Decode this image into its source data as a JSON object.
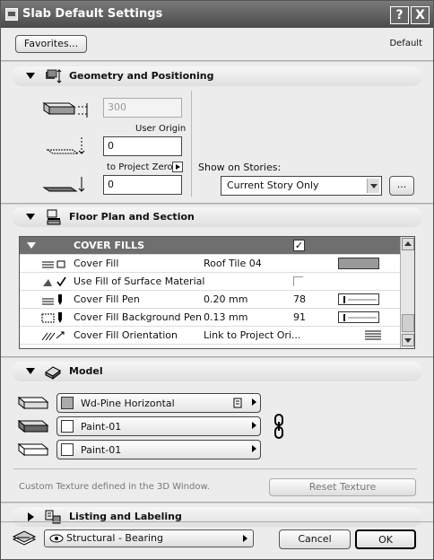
{
  "window": {
    "title": "Slab Default Settings",
    "help_glyph": "?",
    "close_glyph": "X"
  },
  "toolbar": {
    "favorites_label": "Favorites...",
    "default_label": "Default"
  },
  "geometry": {
    "section_title": "Geometry and Positioning",
    "thickness_value": "300",
    "user_origin_label": "User Origin",
    "offset_value": "0",
    "to_project_zero_label": "to Project Zero",
    "elevation_value": "0",
    "show_on_stories_label": "Show on Stories:",
    "stories_selected": "Current Story Only",
    "ellipsis_label": "..."
  },
  "floor_plan": {
    "section_title": "Floor Plan and Section",
    "header_label": "COVER FILLS",
    "rows": [
      {
        "label": "Cover Fill",
        "value": "Roof Tile 04",
        "num": ""
      },
      {
        "label": "Use Fill of Surface Material",
        "value": "",
        "num": ""
      },
      {
        "label": "Cover Fill Pen",
        "value": "0.20 mm",
        "num": "78"
      },
      {
        "label": "Cover Fill Background Pen",
        "value": "0.13 mm",
        "num": "91"
      },
      {
        "label": "Cover Fill Orientation",
        "value": "Link to Project Ori...",
        "num": ""
      }
    ]
  },
  "model": {
    "section_title": "Model",
    "materials": [
      "Wd-Pine Horizontal",
      "Paint-01",
      "Paint-01"
    ],
    "custom_texture_text": "Custom Texture defined in the 3D Window.",
    "reset_texture_label": "Reset Texture"
  },
  "listing": {
    "section_title": "Listing and Labeling"
  },
  "footer": {
    "layer_selected": "Structural - Bearing",
    "cancel_label": "Cancel",
    "ok_label": "OK"
  },
  "colors": {
    "title_bar": "#5a5a5a",
    "table_header": "#6f6f6f",
    "window_bg": "#ececec"
  }
}
